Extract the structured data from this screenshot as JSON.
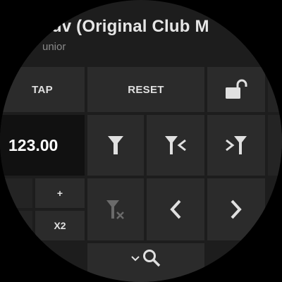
{
  "track": {
    "title": "Luv (Original Club M",
    "artist": "unior"
  },
  "controls": {
    "tap_label": "TAP",
    "reset_label": "RESET",
    "bpm_value": "123.00",
    "plus_label": "+",
    "x2_label": "X2"
  },
  "icons": {
    "lock": "unlocked-padlock-icon",
    "filter": "filter-icon",
    "filter_left": "filter-skip-back-icon",
    "filter_right": "filter-skip-forward-icon",
    "filter_clear": "filter-clear-icon",
    "prev": "chevron-left-icon",
    "next": "chevron-right-icon",
    "expand": "chevron-down-icon",
    "search": "search-icon"
  },
  "colors": {
    "background": "#1d1d1d",
    "cell": "#2b2b2b",
    "bpm_cell": "#111111",
    "text": "#e0e0e0",
    "muted": "#8a8a8a"
  }
}
